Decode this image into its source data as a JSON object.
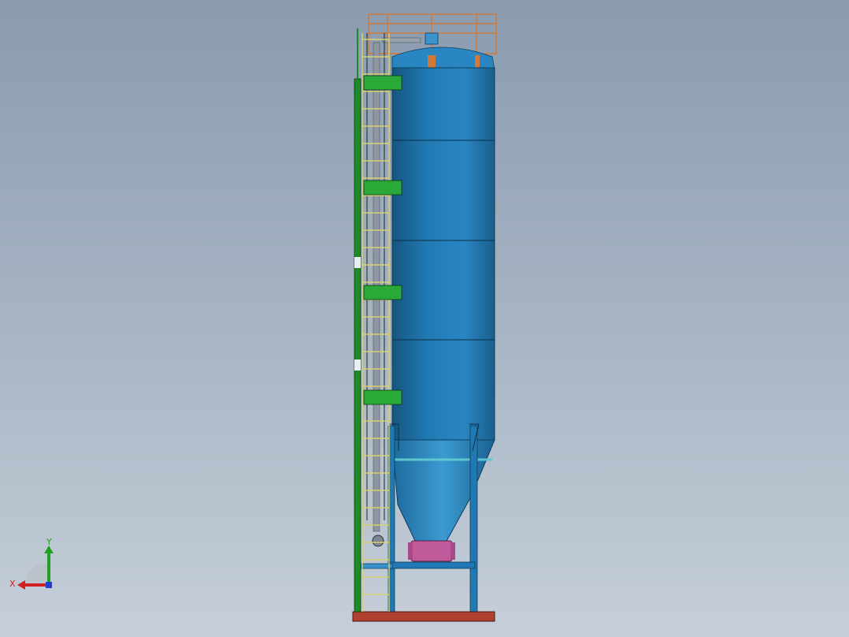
{
  "viewport": {
    "background_top": "#8a9bb0",
    "background_bottom": "#c6cfd9"
  },
  "model": {
    "components": [
      "silo-body",
      "cone-hopper",
      "ladder",
      "cage-rail",
      "top-handrail",
      "support-legs",
      "base-frame",
      "discharge-valve",
      "mounting-brackets",
      "fill-pipe"
    ],
    "colors": {
      "silo": "#1e6fa8",
      "silo_highlight": "#3a93cc",
      "ladder": "#d8d070",
      "cage": "#1e8a2a",
      "bracket": "#2aa838",
      "handrail": "#d07a3a",
      "base": "#b04030",
      "valve": "#c05a9a",
      "legs": "#1e6fa8"
    }
  },
  "triad": {
    "x_label": "X",
    "y_label": "Y",
    "x_color": "#d02020",
    "y_color": "#20a020",
    "z_color": "#2040d0"
  }
}
